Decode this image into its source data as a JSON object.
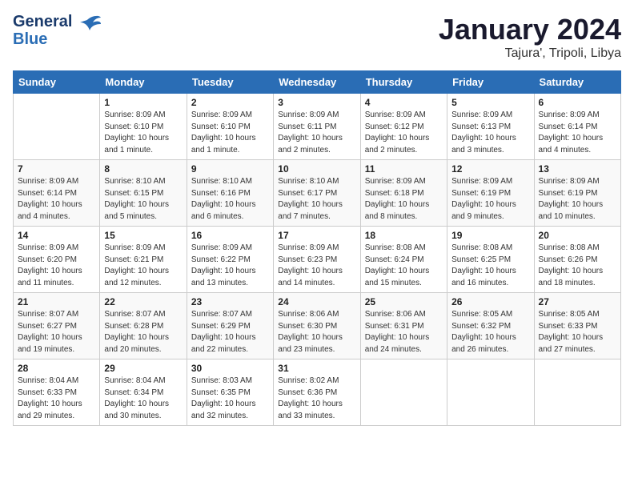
{
  "header": {
    "logo_line1": "General",
    "logo_line2": "Blue",
    "month": "January 2024",
    "location": "Tajura', Tripoli, Libya"
  },
  "weekdays": [
    "Sunday",
    "Monday",
    "Tuesday",
    "Wednesday",
    "Thursday",
    "Friday",
    "Saturday"
  ],
  "weeks": [
    [
      {
        "day": "",
        "info": ""
      },
      {
        "day": "1",
        "info": "Sunrise: 8:09 AM\nSunset: 6:10 PM\nDaylight: 10 hours\nand 1 minute."
      },
      {
        "day": "2",
        "info": "Sunrise: 8:09 AM\nSunset: 6:10 PM\nDaylight: 10 hours\nand 1 minute."
      },
      {
        "day": "3",
        "info": "Sunrise: 8:09 AM\nSunset: 6:11 PM\nDaylight: 10 hours\nand 2 minutes."
      },
      {
        "day": "4",
        "info": "Sunrise: 8:09 AM\nSunset: 6:12 PM\nDaylight: 10 hours\nand 2 minutes."
      },
      {
        "day": "5",
        "info": "Sunrise: 8:09 AM\nSunset: 6:13 PM\nDaylight: 10 hours\nand 3 minutes."
      },
      {
        "day": "6",
        "info": "Sunrise: 8:09 AM\nSunset: 6:14 PM\nDaylight: 10 hours\nand 4 minutes."
      }
    ],
    [
      {
        "day": "7",
        "info": "Sunrise: 8:09 AM\nSunset: 6:14 PM\nDaylight: 10 hours\nand 4 minutes."
      },
      {
        "day": "8",
        "info": "Sunrise: 8:10 AM\nSunset: 6:15 PM\nDaylight: 10 hours\nand 5 minutes."
      },
      {
        "day": "9",
        "info": "Sunrise: 8:10 AM\nSunset: 6:16 PM\nDaylight: 10 hours\nand 6 minutes."
      },
      {
        "day": "10",
        "info": "Sunrise: 8:10 AM\nSunset: 6:17 PM\nDaylight: 10 hours\nand 7 minutes."
      },
      {
        "day": "11",
        "info": "Sunrise: 8:09 AM\nSunset: 6:18 PM\nDaylight: 10 hours\nand 8 minutes."
      },
      {
        "day": "12",
        "info": "Sunrise: 8:09 AM\nSunset: 6:19 PM\nDaylight: 10 hours\nand 9 minutes."
      },
      {
        "day": "13",
        "info": "Sunrise: 8:09 AM\nSunset: 6:19 PM\nDaylight: 10 hours\nand 10 minutes."
      }
    ],
    [
      {
        "day": "14",
        "info": "Sunrise: 8:09 AM\nSunset: 6:20 PM\nDaylight: 10 hours\nand 11 minutes."
      },
      {
        "day": "15",
        "info": "Sunrise: 8:09 AM\nSunset: 6:21 PM\nDaylight: 10 hours\nand 12 minutes."
      },
      {
        "day": "16",
        "info": "Sunrise: 8:09 AM\nSunset: 6:22 PM\nDaylight: 10 hours\nand 13 minutes."
      },
      {
        "day": "17",
        "info": "Sunrise: 8:09 AM\nSunset: 6:23 PM\nDaylight: 10 hours\nand 14 minutes."
      },
      {
        "day": "18",
        "info": "Sunrise: 8:08 AM\nSunset: 6:24 PM\nDaylight: 10 hours\nand 15 minutes."
      },
      {
        "day": "19",
        "info": "Sunrise: 8:08 AM\nSunset: 6:25 PM\nDaylight: 10 hours\nand 16 minutes."
      },
      {
        "day": "20",
        "info": "Sunrise: 8:08 AM\nSunset: 6:26 PM\nDaylight: 10 hours\nand 18 minutes."
      }
    ],
    [
      {
        "day": "21",
        "info": "Sunrise: 8:07 AM\nSunset: 6:27 PM\nDaylight: 10 hours\nand 19 minutes."
      },
      {
        "day": "22",
        "info": "Sunrise: 8:07 AM\nSunset: 6:28 PM\nDaylight: 10 hours\nand 20 minutes."
      },
      {
        "day": "23",
        "info": "Sunrise: 8:07 AM\nSunset: 6:29 PM\nDaylight: 10 hours\nand 22 minutes."
      },
      {
        "day": "24",
        "info": "Sunrise: 8:06 AM\nSunset: 6:30 PM\nDaylight: 10 hours\nand 23 minutes."
      },
      {
        "day": "25",
        "info": "Sunrise: 8:06 AM\nSunset: 6:31 PM\nDaylight: 10 hours\nand 24 minutes."
      },
      {
        "day": "26",
        "info": "Sunrise: 8:05 AM\nSunset: 6:32 PM\nDaylight: 10 hours\nand 26 minutes."
      },
      {
        "day": "27",
        "info": "Sunrise: 8:05 AM\nSunset: 6:33 PM\nDaylight: 10 hours\nand 27 minutes."
      }
    ],
    [
      {
        "day": "28",
        "info": "Sunrise: 8:04 AM\nSunset: 6:33 PM\nDaylight: 10 hours\nand 29 minutes."
      },
      {
        "day": "29",
        "info": "Sunrise: 8:04 AM\nSunset: 6:34 PM\nDaylight: 10 hours\nand 30 minutes."
      },
      {
        "day": "30",
        "info": "Sunrise: 8:03 AM\nSunset: 6:35 PM\nDaylight: 10 hours\nand 32 minutes."
      },
      {
        "day": "31",
        "info": "Sunrise: 8:02 AM\nSunset: 6:36 PM\nDaylight: 10 hours\nand 33 minutes."
      },
      {
        "day": "",
        "info": ""
      },
      {
        "day": "",
        "info": ""
      },
      {
        "day": "",
        "info": ""
      }
    ]
  ]
}
